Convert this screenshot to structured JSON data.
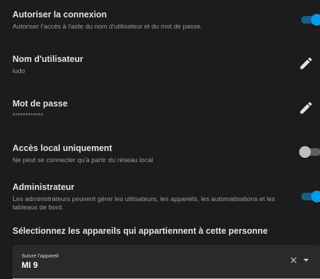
{
  "allow_login": {
    "title": "Autoriser la connexion",
    "description": "Autoriser l'accès à l'aide du nom d'utilisateur et du mot de passe.",
    "enabled": true
  },
  "username": {
    "label": "Nom d'utilisateur",
    "value": "ludo",
    "edit_icon": "pencil-icon"
  },
  "password": {
    "label": "Mot de passe",
    "value": "************",
    "edit_icon": "pencil-icon"
  },
  "local_only": {
    "title": "Accès local uniquement",
    "description": "Ne peut se connecter qu'à partir du réseau local",
    "enabled": false
  },
  "admin": {
    "title": "Administrateur",
    "description": "Les administrateurs peuvent gérer les utilisateurs, les appareils, les automatisations et les tableaux de bord.",
    "enabled": true
  },
  "devices": {
    "heading": "Sélectionnez les appareils qui appartiennent à cette personne",
    "select_label": "Suivre l'appareil",
    "select_value": "MI 9",
    "clear_icon": "close-icon",
    "dropdown_icon": "chevron-down-icon"
  },
  "colors": {
    "accent": "#039be5",
    "background": "#1c1c1c"
  }
}
